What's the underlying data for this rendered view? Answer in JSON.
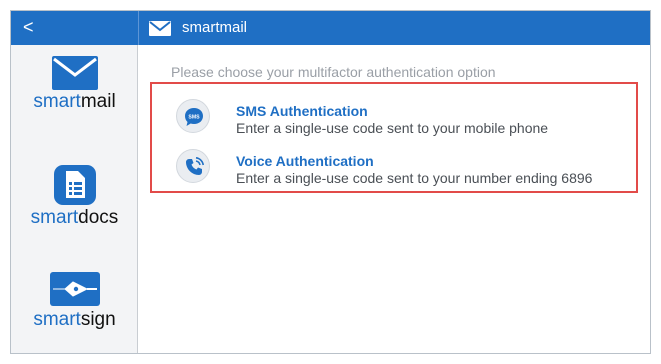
{
  "nav": {
    "back_label": "<"
  },
  "header": {
    "title": "smartmail",
    "icon": "envelope-icon"
  },
  "sidebar": {
    "apps": [
      {
        "accent": "smart",
        "rest": "mail",
        "icon": "envelope-icon"
      },
      {
        "accent": "smart",
        "rest": "docs",
        "icon": "document-icon"
      },
      {
        "accent": "smart",
        "rest": "sign",
        "icon": "pen-nib-icon"
      }
    ]
  },
  "main": {
    "prompt": "Please choose your multifactor authentication option",
    "options": [
      {
        "title": "SMS Authentication",
        "description": "Enter a single-use code sent to your mobile phone",
        "icon": "sms-bubble-icon",
        "icon_text": "SMS"
      },
      {
        "title": "Voice Authentication",
        "description": "Enter a single-use code sent to your number ending 6896",
        "icon": "phone-icon"
      }
    ]
  },
  "colors": {
    "brand_blue": "#1f6fc4",
    "highlight_red": "#e24b49",
    "sidebar_bg": "#f3f4f6"
  }
}
